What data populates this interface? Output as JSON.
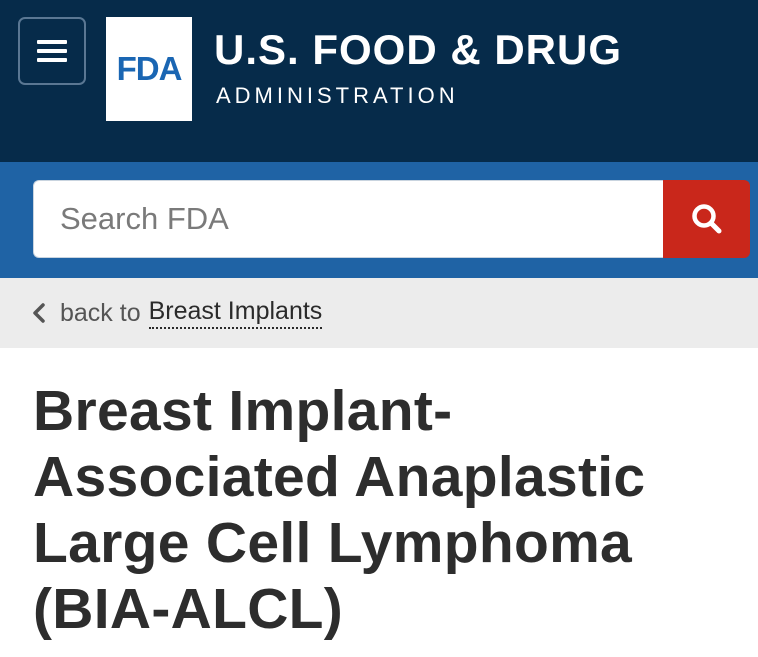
{
  "header": {
    "logo_text": "FDA",
    "agency_name": "U.S. FOOD & DRUG",
    "agency_sub": "ADMINISTRATION"
  },
  "search": {
    "placeholder": "Search FDA"
  },
  "breadcrumb": {
    "back_label": "back to",
    "link_text": "Breast Implants"
  },
  "main": {
    "title": "Breast Implant-Associated Anaplastic Large Cell Lymphoma (BIA-ALCL)"
  },
  "colors": {
    "header_bg": "#062b4a",
    "search_band_bg": "#1f63a5",
    "search_button": "#c9271b",
    "breadcrumb_bg": "#ececec",
    "logo_blue": "#1a66b3"
  },
  "icons": {
    "menu": "hamburger-icon",
    "search": "search-icon",
    "back": "chevron-left-icon"
  }
}
